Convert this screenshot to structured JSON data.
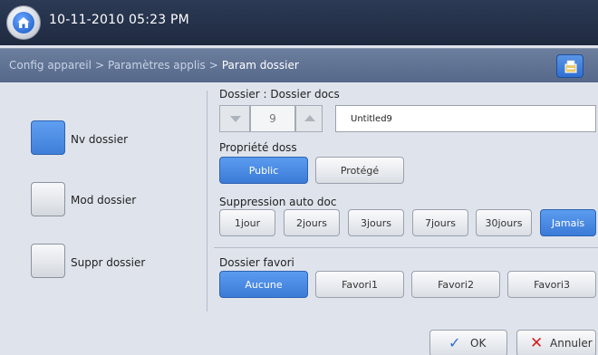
{
  "header": {
    "datetime": "10-11-2010 05:23 PM"
  },
  "breadcrumb": {
    "items": [
      "Config appareil",
      "Paramètres applis",
      "Param dossier"
    ],
    "separator": ">"
  },
  "left_options": [
    {
      "label": "Nv dossier",
      "selected": true
    },
    {
      "label": "Mod dossier",
      "selected": false
    },
    {
      "label": "Suppr dossier",
      "selected": false
    }
  ],
  "folder": {
    "label": "Dossier : Dossier docs",
    "number": "9",
    "name": "Untitled9"
  },
  "property": {
    "label": "Propriété doss",
    "options": [
      "Public",
      "Protégé"
    ],
    "selected": "Public"
  },
  "auto_delete": {
    "label": "Suppression auto doc",
    "options": [
      "1jour",
      "2jours",
      "3jours",
      "7jours",
      "30jours",
      "Jamais"
    ],
    "selected": "Jamais"
  },
  "favorite": {
    "label": "Dossier favori",
    "options": [
      "Aucune",
      "Favori1",
      "Favori2",
      "Favori3"
    ],
    "selected": "Aucune"
  },
  "footer": {
    "ok_label": "OK",
    "cancel_label": "Annuler"
  },
  "colors": {
    "accent_blue": "#3f7fd8",
    "topbar": "#1f2a40",
    "breadcrumb_bar": "#56688a",
    "cancel_red": "#d42020",
    "ok_blue": "#2a6fd1"
  },
  "icons": {
    "home": "home-icon",
    "breadcrumb_action": "job-queue-icon",
    "stepper_down": "triangle-down-icon",
    "stepper_up": "triangle-up-icon",
    "ok": "checkmark-icon",
    "cancel": "x-icon"
  }
}
